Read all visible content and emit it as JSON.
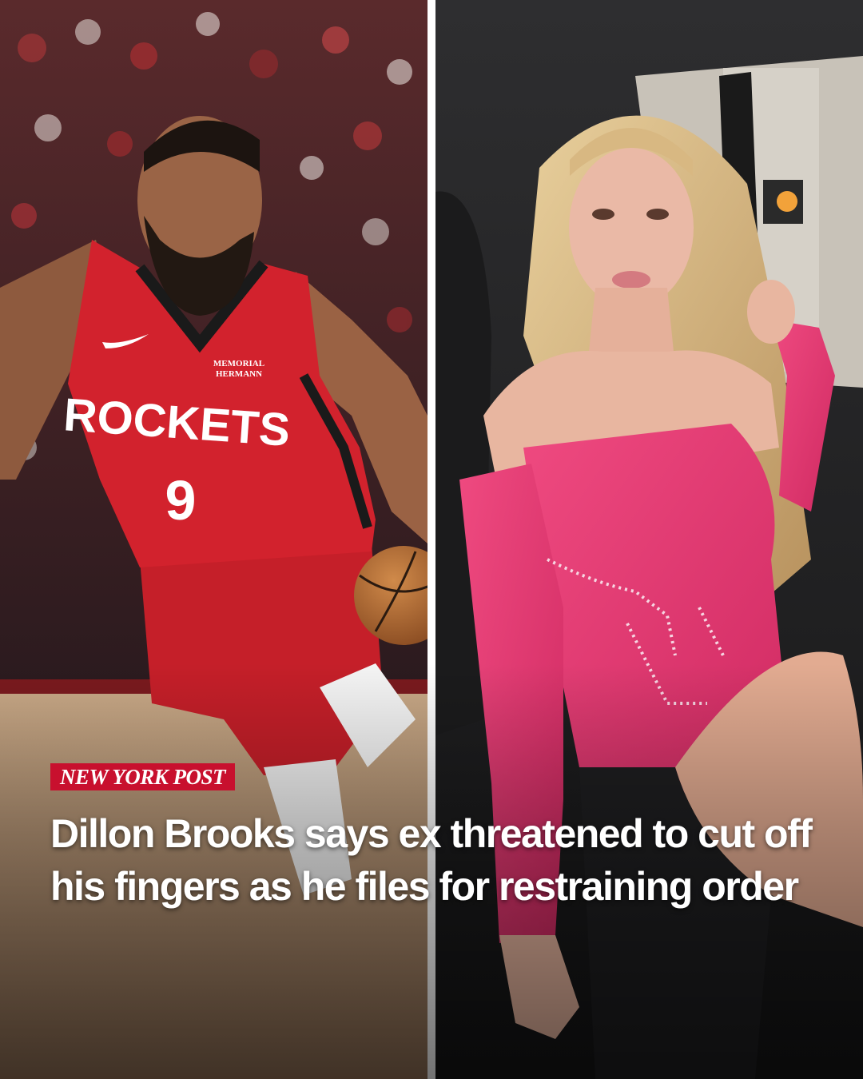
{
  "brand": {
    "name": "NEW YORK POST",
    "color": "#c8102e"
  },
  "headline": {
    "text": "Dillon Brooks says ex threatened to cut off his fingers as he files for restraining order"
  },
  "left_photo": {
    "jersey_team": "ROCKETS",
    "jersey_number": "9",
    "jersey_sponsor_line1": "MEMORIAL",
    "jersey_sponsor_line2": "HERMANN",
    "jersey_color": "#d2222d"
  },
  "right_photo": {
    "dress_color": "#e6356f"
  }
}
